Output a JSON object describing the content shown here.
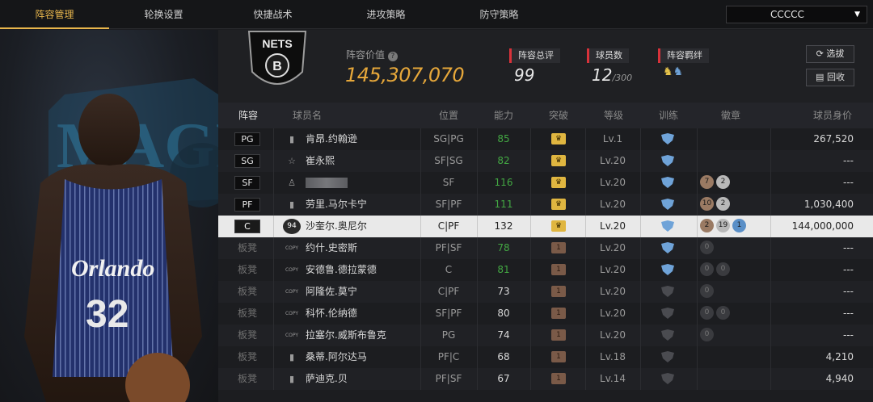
{
  "nav": {
    "tabs": [
      "阵容管理",
      "轮换设置",
      "快捷战术",
      "进攻策略",
      "防守策略"
    ],
    "active_tab": "阵容管理",
    "account_select": "CCCCC"
  },
  "header": {
    "value_label": "阵容价值",
    "value": "145,307,070",
    "stats": [
      {
        "label": "阵容总评",
        "value": "99",
        "suffix": ""
      },
      {
        "label": "球员数",
        "value": "12",
        "suffix": "/300"
      },
      {
        "label": "阵容羁绊",
        "value": "",
        "suffix": ""
      }
    ],
    "buttons": {
      "select": "选拔",
      "recycle": "回收"
    }
  },
  "table": {
    "headers": [
      "阵容",
      "球员名",
      "位置",
      "能力",
      "突破",
      "等级",
      "训练",
      "徽章",
      "球员身价"
    ],
    "rows": [
      {
        "slot": "PG",
        "starter": true,
        "icon": "signal-icon",
        "name": "肯昂.约翰逊",
        "pos": "SG|PG",
        "ability": "85",
        "ability_color": "#43a843",
        "crown": "gold",
        "level": "Lv.1",
        "train": "blue",
        "medals": [],
        "value": "267,520"
      },
      {
        "slot": "SG",
        "starter": true,
        "icon": "star-icon",
        "name": "崔永熙",
        "pos": "SF|SG",
        "ability": "82",
        "ability_color": "#43a843",
        "crown": "gold",
        "level": "Lv.20",
        "train": "blue",
        "medals": [],
        "value": "---"
      },
      {
        "slot": "SF",
        "starter": true,
        "icon": "person-icon",
        "name": "",
        "pos": "SF",
        "ability": "116",
        "ability_color": "#43a843",
        "crown": "gold",
        "level": "Lv.20",
        "train": "blue",
        "medals": [
          "7",
          "2"
        ],
        "value": "---"
      },
      {
        "slot": "PF",
        "starter": true,
        "icon": "signal-icon",
        "name": "劳里.马尔卡宁",
        "pos": "SF|PF",
        "ability": "111",
        "ability_color": "#43a843",
        "crown": "gold",
        "level": "Lv.20",
        "train": "blue",
        "medals": [
          "10",
          "2"
        ],
        "value": "1,030,400"
      },
      {
        "slot": "C",
        "starter": true,
        "selected": true,
        "icon": "badge-94-icon",
        "name": "沙奎尔.奥尼尔",
        "pos": "C|PF",
        "ability": "132",
        "ability_color": "#222222",
        "crown": "gold",
        "level": "Lv.20",
        "train": "blue",
        "medals": [
          "2",
          "19",
          "1"
        ],
        "value": "144,000,000"
      },
      {
        "slot": "板凳",
        "starter": false,
        "icon": "copy-icon",
        "name": "约什.史密斯",
        "pos": "PF|SF",
        "ability": "78",
        "ability_color": "#43a843",
        "crown": "brown",
        "level": "Lv.20",
        "train": "blue",
        "medals": [
          "0"
        ],
        "value": "---"
      },
      {
        "slot": "板凳",
        "starter": false,
        "icon": "copy-icon",
        "name": "安德鲁.德拉蒙德",
        "pos": "C",
        "ability": "81",
        "ability_color": "#43a843",
        "crown": "brown",
        "level": "Lv.20",
        "train": "blue",
        "medals": [
          "0",
          "0"
        ],
        "value": "---"
      },
      {
        "slot": "板凳",
        "starter": false,
        "icon": "copy-icon",
        "name": "阿隆佐.莫宁",
        "pos": "C|PF",
        "ability": "73",
        "ability_color": "#d9d9d9",
        "crown": "brown",
        "level": "Lv.20",
        "train": "grey",
        "medals": [
          "0"
        ],
        "value": "---"
      },
      {
        "slot": "板凳",
        "starter": false,
        "icon": "copy-icon",
        "name": "科怀.伦纳德",
        "pos": "SF|PF",
        "ability": "80",
        "ability_color": "#d9d9d9",
        "crown": "brown",
        "level": "Lv.20",
        "train": "grey",
        "medals": [
          "0",
          "0"
        ],
        "value": "---"
      },
      {
        "slot": "板凳",
        "starter": false,
        "icon": "copy-icon",
        "name": "拉塞尔.威斯布鲁克",
        "pos": "PG",
        "ability": "74",
        "ability_color": "#d9d9d9",
        "crown": "brown",
        "level": "Lv.20",
        "train": "grey",
        "medals": [
          "0"
        ],
        "value": "---"
      },
      {
        "slot": "板凳",
        "starter": false,
        "icon": "signal-icon",
        "name": "桑蒂.阿尔达马",
        "pos": "PF|C",
        "ability": "68",
        "ability_color": "#d9d9d9",
        "crown": "brown",
        "level": "Lv.18",
        "train": "grey",
        "medals": [],
        "value": "4,210"
      },
      {
        "slot": "板凳",
        "starter": false,
        "icon": "signal-icon",
        "name": "萨迪克.贝",
        "pos": "PF|SF",
        "ability": "67",
        "ability_color": "#d9d9d9",
        "crown": "brown",
        "level": "Lv.14",
        "train": "grey",
        "medals": [],
        "value": "4,940"
      }
    ]
  },
  "colors": {
    "accent": "#e8b64c",
    "value_gold": "#e6a73a",
    "stat_red": "#d8323a",
    "train_blue": "#6fa3d8"
  },
  "player_card": {
    "jersey_text": "Orlando",
    "number": "32"
  },
  "team_logo_text": "NETS"
}
